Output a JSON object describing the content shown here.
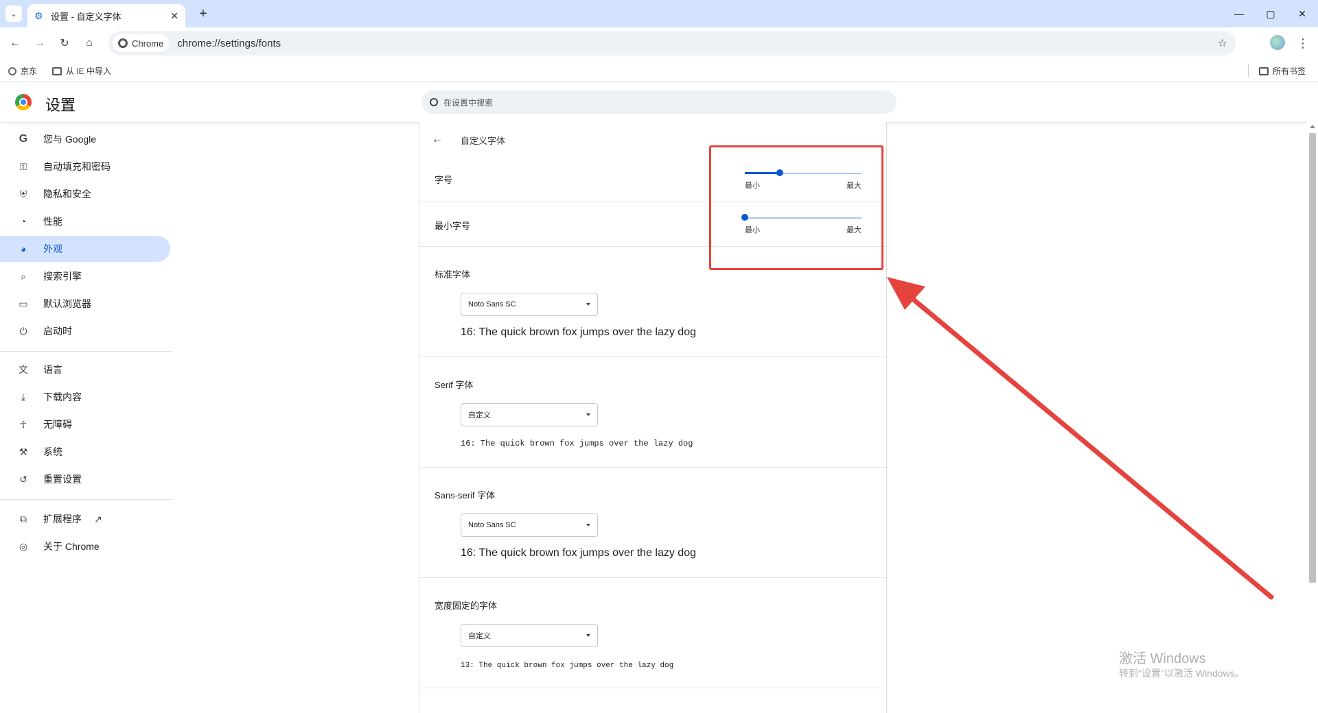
{
  "browser": {
    "tab_title": "设置 - 自定义字体",
    "url_chip": "Chrome",
    "url": "chrome://settings/fonts",
    "window_controls": [
      "—",
      "▢",
      "✕"
    ]
  },
  "bookmarks": {
    "items": [
      "京东",
      "从 IE 中导入"
    ],
    "all_bookmarks": "所有书签"
  },
  "settings": {
    "title": "设置",
    "search_placeholder": "在设置中搜索"
  },
  "sidebar": {
    "items": [
      {
        "label": "您与 Google",
        "icon": "google-icon"
      },
      {
        "label": "自动填充和密码",
        "icon": "key-icon"
      },
      {
        "label": "隐私和安全",
        "icon": "shield-icon"
      },
      {
        "label": "性能",
        "icon": "gauge-icon"
      },
      {
        "label": "外观",
        "icon": "palette-icon",
        "active": true
      },
      {
        "label": "搜索引擎",
        "icon": "search-icon"
      },
      {
        "label": "默认浏览器",
        "icon": "browser-icon"
      },
      {
        "label": "启动时",
        "icon": "power-icon"
      },
      {
        "label": "语言",
        "icon": "translate-icon"
      },
      {
        "label": "下载内容",
        "icon": "download-icon"
      },
      {
        "label": "无障碍",
        "icon": "accessibility-icon"
      },
      {
        "label": "系统",
        "icon": "wrench-icon"
      },
      {
        "label": "重置设置",
        "icon": "reset-icon"
      },
      {
        "label": "扩展程序",
        "icon": "extension-icon"
      },
      {
        "label": "关于 Chrome",
        "icon": "chrome-icon"
      }
    ]
  },
  "fonts_page": {
    "header": "自定义字体",
    "font_size": {
      "label": "字号",
      "min_label": "最小",
      "max_label": "最大",
      "value": 0.3
    },
    "min_font_size": {
      "label": "最小字号",
      "min_label": "最小",
      "max_label": "最大",
      "value": 0.0
    },
    "standard": {
      "label": "标准字体",
      "selected": "Noto Sans SC",
      "sample": "16: The quick brown fox jumps over the lazy dog"
    },
    "serif": {
      "label": "Serif 字体",
      "selected": "自定义",
      "sample": "16: The quick brown fox jumps over the lazy dog"
    },
    "sans_serif": {
      "label": "Sans-serif 字体",
      "selected": "Noto Sans SC",
      "sample": "16: The quick brown fox jumps over the lazy dog"
    },
    "fixed_width": {
      "label": "宽度固定的字体",
      "selected": "自定义",
      "sample": "13: The quick brown fox jumps over the lazy dog"
    }
  },
  "watermark": {
    "line1": "激活 Windows",
    "line2": "转到\"设置\"以激活 Windows。"
  },
  "colors": {
    "accent": "#0b57d0",
    "annotation": "#e5433d",
    "active_nav_bg": "#d3e3fd"
  }
}
